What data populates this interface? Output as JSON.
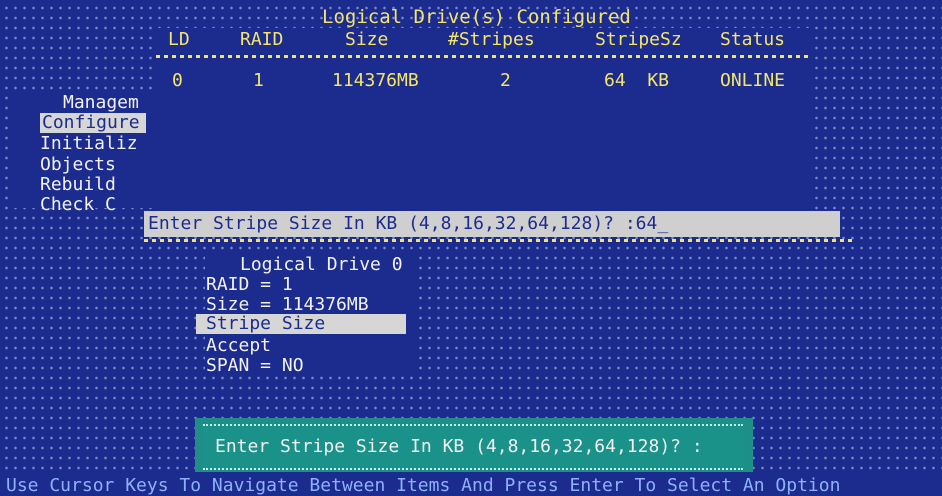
{
  "top_panel": {
    "title": "Logical Drive(s) Configured",
    "columns": [
      "LD",
      "RAID",
      "Size",
      "#Stripes",
      "StripeSz",
      "Status"
    ],
    "row": {
      "ld": "0",
      "raid": "1",
      "size": "114376MB",
      "stripes": "2",
      "stripe_sz": "64  KB",
      "status": "ONLINE"
    }
  },
  "left_menu": {
    "items": [
      "Managem",
      "Configure",
      "Initializ",
      "Objects",
      "Rebuild",
      "Check C"
    ]
  },
  "top_prompt": {
    "text": "Enter Stripe Size In KB (4,8,16,32,64,128)? :64_"
  },
  "ld_panel": {
    "title": "Logical Drive 0",
    "items": [
      "RAID = 1",
      "Size = 114376MB",
      "Stripe Size",
      "Accept",
      "SPAN = NO"
    ]
  },
  "dialog": {
    "text": "Enter Stripe Size In KB (4,8,16,32,64,128)? :"
  },
  "status_bar": {
    "text": "Use Cursor Keys To Navigate Between Items And Press Enter To Select An Option"
  },
  "colors": {
    "background": "#1c2b8e",
    "yellow_text": "#f4e56a",
    "white_text": "#f2f2f2",
    "highlight": "#cfcfcf",
    "dialog": "#1e8f87"
  }
}
